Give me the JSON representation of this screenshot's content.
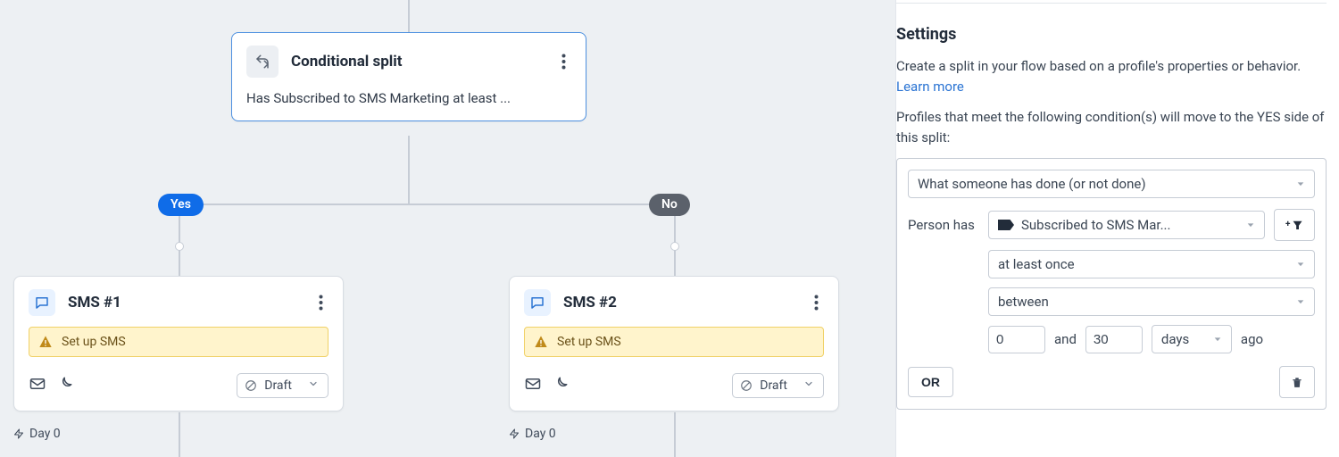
{
  "canvas": {
    "split": {
      "title": "Conditional split",
      "description": "Has Subscribed to SMS Marketing at least ...",
      "yes_label": "Yes",
      "no_label": "No"
    },
    "cards": {
      "sms1": {
        "title": "SMS #1",
        "warning": "Set up SMS",
        "status": "Draft",
        "day": "Day 0"
      },
      "sms2": {
        "title": "SMS #2",
        "warning": "Set up SMS",
        "status": "Draft",
        "day": "Day 0"
      }
    }
  },
  "panel": {
    "title": "Settings",
    "description_1": "Create a split in your flow based on a profile's properties or behavior. ",
    "learn_more": "Learn more",
    "description_2": "Profiles that meet the following condition(s) will move to the YES side of this split:",
    "condition": {
      "dimension": "What someone has done (or not done)",
      "person_label": "Person",
      "has_label": "has",
      "event": "Subscribed to SMS Mar...",
      "frequency": "at least once",
      "timeframe": "between",
      "from": "0",
      "and_label": "and",
      "to": "30",
      "unit": "days",
      "ago_label": "ago"
    },
    "or_label": "OR"
  }
}
